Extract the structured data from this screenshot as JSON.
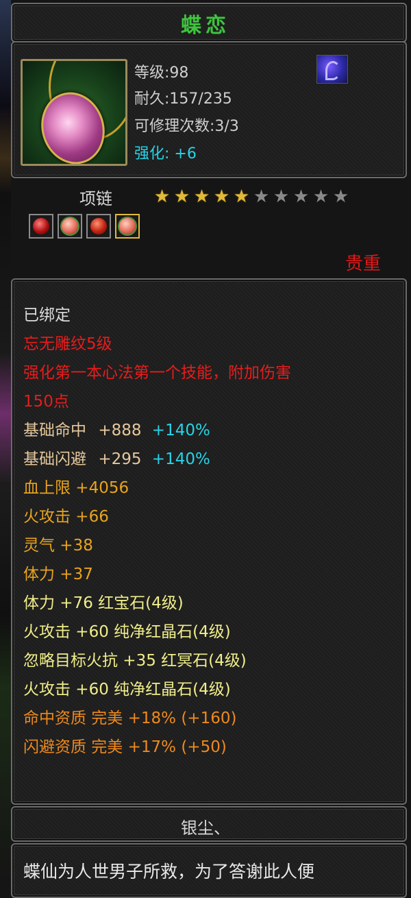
{
  "item": {
    "name": "蝶恋",
    "level": "等级:98",
    "durability": "耐久:157/235",
    "repairs": "可修理次数:3/3",
    "enhance_label": "强化:",
    "enhance_value": "+6",
    "type": "项链",
    "stars_filled": 5,
    "stars_total": 10,
    "gems": [
      "red-gem-icon",
      "pink-gem-icon",
      "red-gem-icon",
      "pink-gem-icon"
    ],
    "quality": "贵重"
  },
  "attributes": {
    "bound": "已绑定",
    "engraving": "忘无雕纹5级",
    "effect_line1": "强化第一本心法第一个技能，附加伤害",
    "effect_line2": "150点",
    "base_hit_label": "基础命中",
    "base_hit_value": "+888",
    "base_hit_pct": "+140%",
    "base_dodge_label": "基础闪避",
    "base_dodge_value": "+295",
    "base_dodge_pct": "+140%",
    "hp": "血上限  +4056",
    "fire_atk": "火攻击  +66",
    "spirit": "灵气  +38",
    "stamina": "体力  +37",
    "gem_stats": [
      "体力  +76  红宝石(4级)",
      "火攻击  +60  纯净红晶石(4级)",
      "忽略目标火抗  +35  红冥石(4级)",
      "火攻击  +60  纯净红晶石(4级)"
    ],
    "aptitudes": [
      "命中资质    完美  +18% (+160)",
      "闪避资质    完美  +17% (+50)"
    ]
  },
  "footer": {
    "maker": "银尘、",
    "description": "蝶仙为人世男子所救，为了答谢此人便"
  },
  "colors": {
    "title": "#3ec43e",
    "quality": "#e01818",
    "enhance": "#27d4e8"
  }
}
